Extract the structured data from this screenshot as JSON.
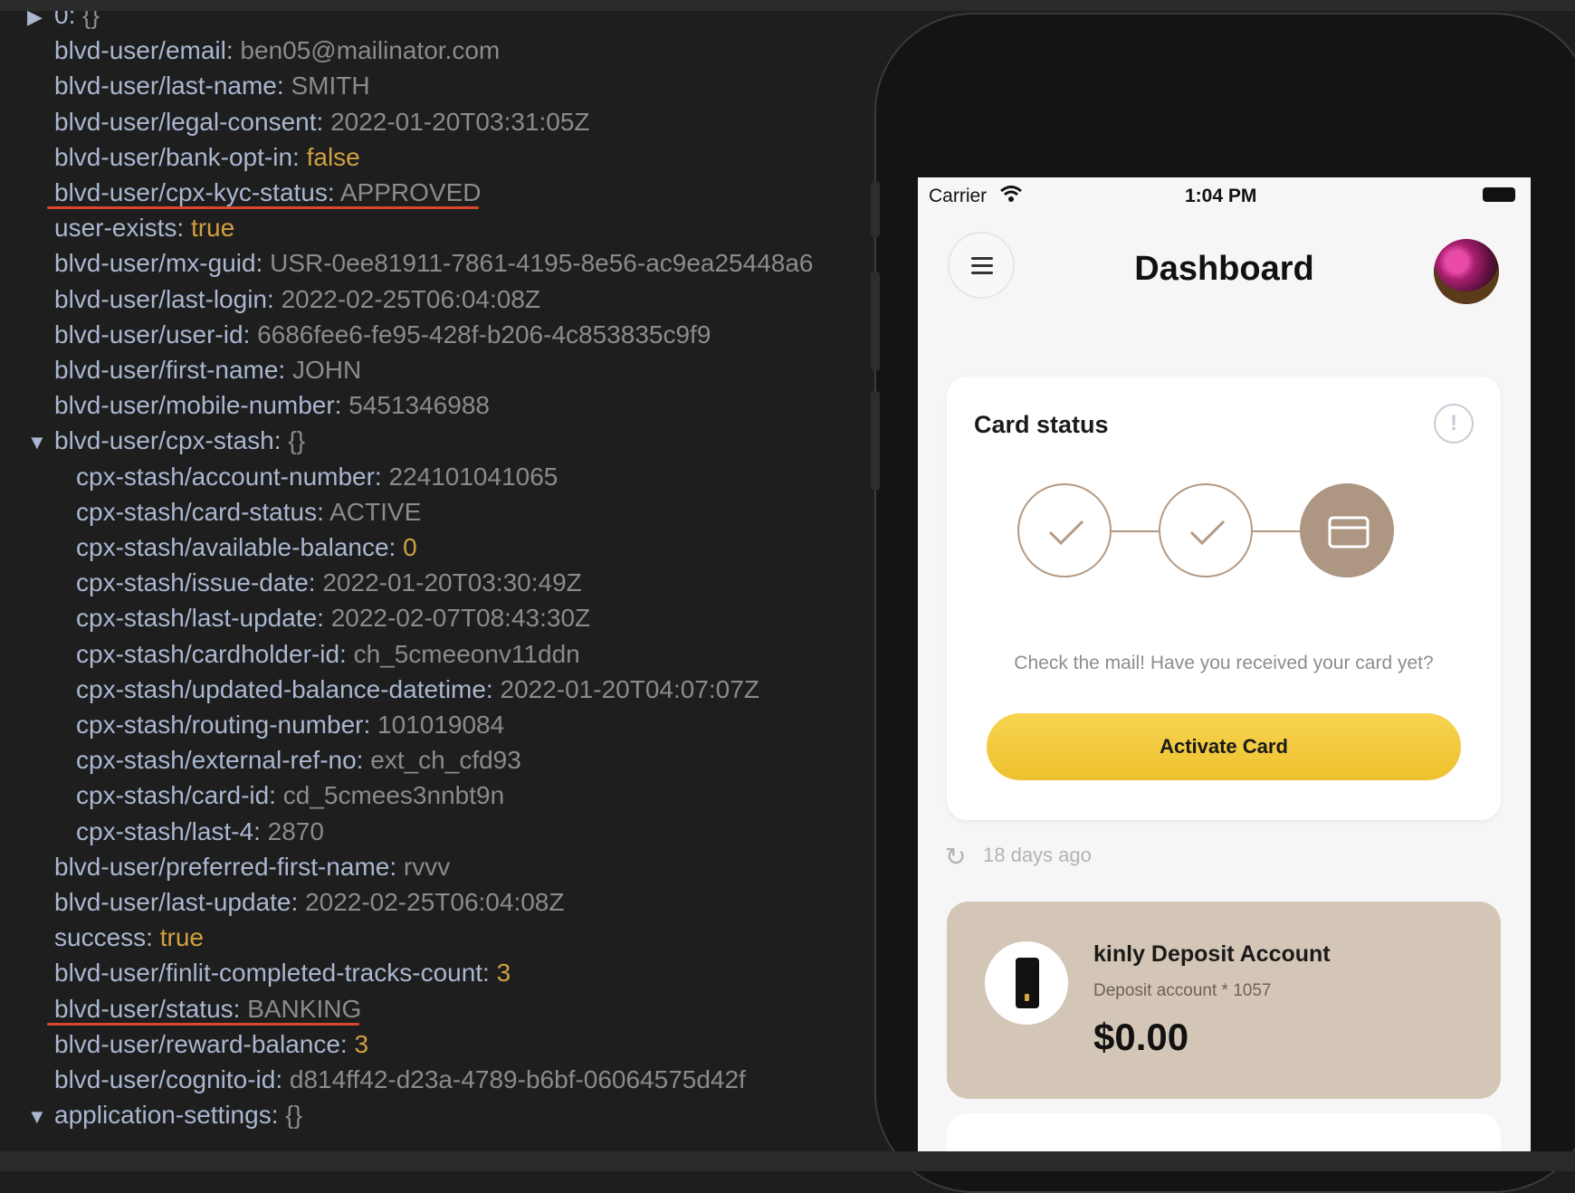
{
  "inspector": {
    "rows": [
      {
        "key": "0:",
        "value": "{}",
        "vtype": "obj",
        "expander": "collapsed"
      },
      {
        "key": "blvd-user/email:",
        "value": "ben05@mailinator.com",
        "vtype": "str"
      },
      {
        "key": "blvd-user/last-name:",
        "value": "SMITH",
        "vtype": "str"
      },
      {
        "key": "blvd-user/legal-consent:",
        "value": "2022-01-20T03:31:05Z",
        "vtype": "str"
      },
      {
        "key": "blvd-user/bank-opt-in:",
        "value": "false",
        "vtype": "bool"
      },
      {
        "key": "blvd-user/cpx-kyc-status:",
        "value": "APPROVED",
        "vtype": "str",
        "underlined": true
      },
      {
        "key": "user-exists:",
        "value": "true",
        "vtype": "bool"
      },
      {
        "key": "blvd-user/mx-guid:",
        "value": "USR-0ee81911-7861-4195-8e56-ac9ea25448a6",
        "vtype": "str"
      },
      {
        "key": "blvd-user/last-login:",
        "value": "2022-02-25T06:04:08Z",
        "vtype": "str"
      },
      {
        "key": "blvd-user/user-id:",
        "value": "6686fee6-fe95-428f-b206-4c853835c9f9",
        "vtype": "str"
      },
      {
        "key": "blvd-user/first-name:",
        "value": "JOHN",
        "vtype": "str"
      },
      {
        "key": "blvd-user/mobile-number:",
        "value": "5451346988",
        "vtype": "str"
      },
      {
        "key": "blvd-user/cpx-stash:",
        "value": "{}",
        "vtype": "obj",
        "expander": "expanded"
      },
      {
        "key": "cpx-stash/account-number:",
        "value": "224101041065",
        "vtype": "str",
        "indent": 1
      },
      {
        "key": "cpx-stash/card-status:",
        "value": "ACTIVE",
        "vtype": "str",
        "indent": 1
      },
      {
        "key": "cpx-stash/available-balance:",
        "value": "0",
        "vtype": "num",
        "indent": 1
      },
      {
        "key": "cpx-stash/issue-date:",
        "value": "2022-01-20T03:30:49Z",
        "vtype": "str",
        "indent": 1
      },
      {
        "key": "cpx-stash/last-update:",
        "value": "2022-02-07T08:43:30Z",
        "vtype": "str",
        "indent": 1
      },
      {
        "key": "cpx-stash/cardholder-id:",
        "value": "ch_5cmeeonv11ddn",
        "vtype": "str",
        "indent": 1
      },
      {
        "key": "cpx-stash/updated-balance-datetime:",
        "value": "2022-01-20T04:07:07Z",
        "vtype": "str",
        "indent": 1
      },
      {
        "key": "cpx-stash/routing-number:",
        "value": "101019084",
        "vtype": "str",
        "indent": 1
      },
      {
        "key": "cpx-stash/external-ref-no:",
        "value": "ext_ch_cfd93",
        "vtype": "str",
        "indent": 1
      },
      {
        "key": "cpx-stash/card-id:",
        "value": "cd_5cmees3nnbt9n",
        "vtype": "str",
        "indent": 1
      },
      {
        "key": "cpx-stash/last-4:",
        "value": "2870",
        "vtype": "str",
        "indent": 1
      },
      {
        "key": "blvd-user/preferred-first-name:",
        "value": "rvvv",
        "vtype": "str"
      },
      {
        "key": "blvd-user/last-update:",
        "value": "2022-02-25T06:04:08Z",
        "vtype": "str"
      },
      {
        "key": "success:",
        "value": "true",
        "vtype": "bool"
      },
      {
        "key": "blvd-user/finlit-completed-tracks-count:",
        "value": "3",
        "vtype": "num"
      },
      {
        "key": "blvd-user/status:",
        "value": "BANKING",
        "vtype": "str",
        "underlined": true
      },
      {
        "key": "blvd-user/reward-balance:",
        "value": "3",
        "vtype": "num"
      },
      {
        "key": "blvd-user/cognito-id:",
        "value": "d814ff42-d23a-4789-b6bf-06064575d42f",
        "vtype": "str"
      },
      {
        "key": "application-settings:",
        "value": "{}",
        "vtype": "obj",
        "expander": "expanded"
      }
    ],
    "colors": {
      "key": "#a9b7d0",
      "string": "#8b8b8b",
      "number": "#d0a040",
      "underline": "#d9472b"
    }
  },
  "phone": {
    "status_bar": {
      "carrier": "Carrier",
      "time": "1:04 PM"
    },
    "header": {
      "title": "Dashboard",
      "menu_icon": "hamburger-icon",
      "avatar": "flower-avatar"
    },
    "card_status": {
      "title": "Card status",
      "info_icon": "info-icon",
      "steps": [
        {
          "state": "done",
          "icon": "check-icon"
        },
        {
          "state": "done",
          "icon": "check-icon"
        },
        {
          "state": "current",
          "icon": "credit-card-icon"
        }
      ],
      "message": "Check the mail! Have you received your card yet?",
      "button_label": "Activate Card"
    },
    "refresh_text": "18 days ago",
    "deposit": {
      "name": "kinly Deposit Account",
      "subtitle": "Deposit account * 1057",
      "balance": "$0.00"
    },
    "colors": {
      "accent_yellow": "#f2c93a",
      "step_brown": "#ad9682",
      "deposit_bg": "#d4c6b6"
    }
  }
}
